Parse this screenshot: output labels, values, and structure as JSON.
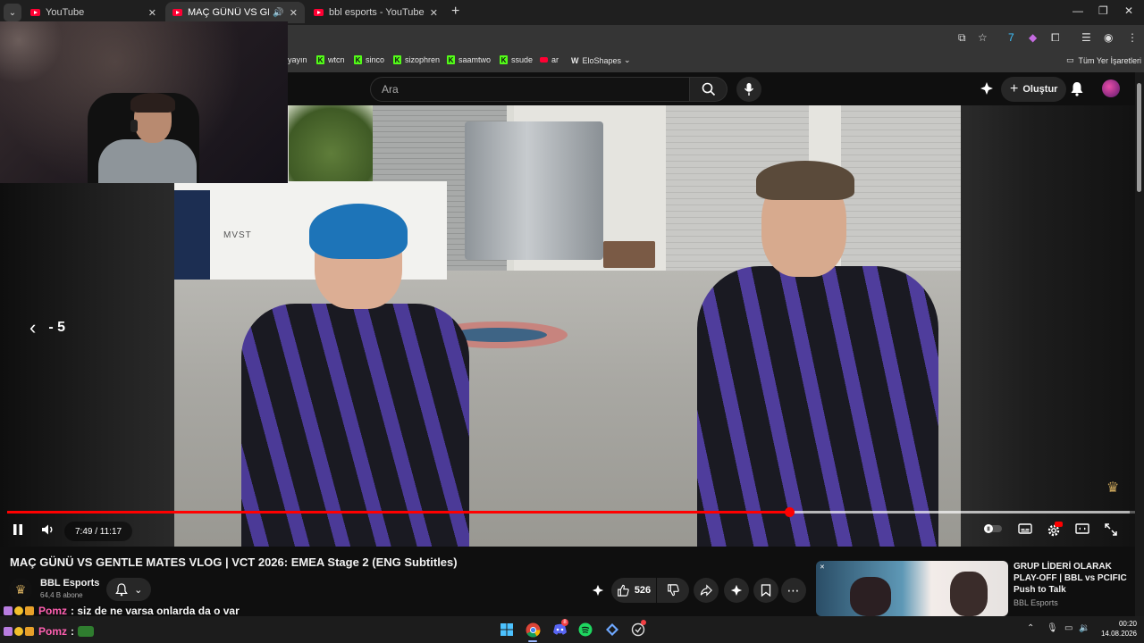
{
  "browser": {
    "tabs": [
      {
        "title": "YouTube",
        "active": false
      },
      {
        "title": "MAÇ GÜNÜ VS GENTLE MATES",
        "active": true
      },
      {
        "title": "bbl esports - YouTube",
        "active": false
      }
    ],
    "bookmarks": {
      "items": [
        "yayın",
        "wtcn",
        "sinco",
        "sizophren",
        "saamtwo",
        "ssude",
        "ar",
        "EloShapes"
      ],
      "all_bookmarks": "Tüm Yer İşaretleri"
    }
  },
  "youtube": {
    "search": {
      "placeholder": "Ara"
    },
    "create_label": "Oluştur"
  },
  "player": {
    "seek_text": "- 5",
    "time": "7:49 / 11:17",
    "progress": 0.6935,
    "buffered": 0.995
  },
  "video": {
    "title": "MAÇ GÜNÜ VS GENTLE MATES VLOG | VCT 2026: EMEA Stage 2 (ENG Subtitles)",
    "channel": {
      "name": "BBL Esports",
      "subscribers": "64,4 B abone"
    },
    "likes": "526"
  },
  "recommendation": {
    "title": "GRUP LİDERİ OLARAK PLAY-OFF | BBL vs PCIFIC Push to Talk",
    "channel": "BBL Esports"
  },
  "chat": [
    {
      "user": "Pomz",
      "message": ": siz de ne varsa onlarda da o var"
    },
    {
      "user": "Pomz",
      "message": ":"
    }
  ],
  "clock": {
    "time": "00:20",
    "date": "14.08.2026"
  },
  "colors": {
    "accent_red": "#ff0000",
    "chat_user": "#ff5fb1",
    "kick_green": "#53fc18"
  }
}
